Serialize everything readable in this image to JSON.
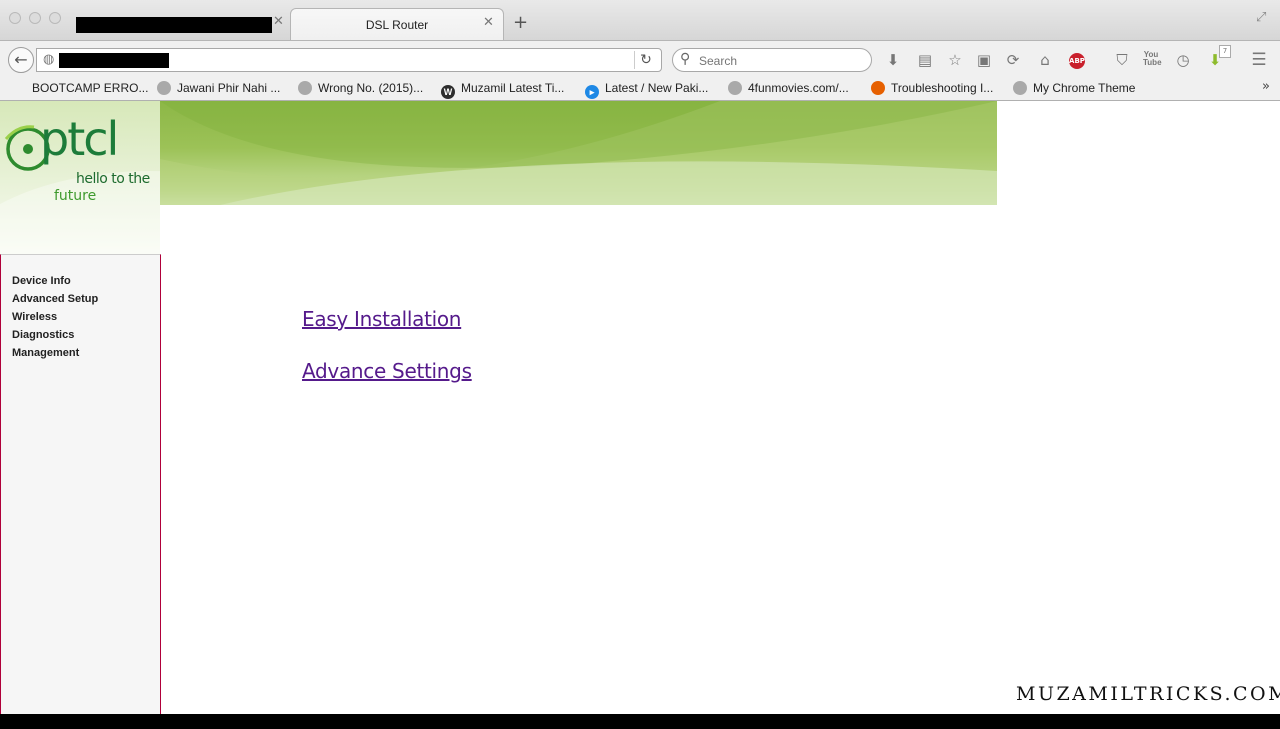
{
  "browser": {
    "tabs": [
      {
        "title": "",
        "redacted": true
      },
      {
        "title": "DSL Router",
        "active": true
      }
    ],
    "new_tab_label": "+",
    "search_placeholder": "Search",
    "toolbar_icons": [
      "download-arrow-icon",
      "folder-icon",
      "star-icon",
      "clipboard-icon",
      "sync-icon",
      "home-icon",
      "adblock-icon",
      "shield-icon",
      "youtube-icon",
      "history-icon",
      "downloader-icon",
      "menu-icon"
    ],
    "abp_label": "ABP",
    "youtube_label": "You Tube",
    "download_badge": "7",
    "bookmarks": [
      {
        "label": "BOOTCAMP ERRO...",
        "icon": "apple-icon"
      },
      {
        "label": "Jawani Phir Nahi ...",
        "icon": "globe-icon"
      },
      {
        "label": "Wrong No. (2015)...",
        "icon": "globe-icon"
      },
      {
        "label": "Muzamil Latest Ti...",
        "icon": "wordpress-icon"
      },
      {
        "label": "Latest / New Paki...",
        "icon": "play-icon"
      },
      {
        "label": "4funmovies.com/...",
        "icon": "globe-icon"
      },
      {
        "label": "Troubleshooting I...",
        "icon": "firefox-icon"
      },
      {
        "label": "My Chrome Theme",
        "icon": "globe-icon"
      }
    ]
  },
  "router": {
    "logo": {
      "brand": "ptcl",
      "tagline_line1": "hello to the",
      "tagline_line2": "future"
    },
    "menu": [
      "Device Info",
      "Advanced Setup",
      "Wireless",
      "Diagnostics",
      "Management"
    ],
    "links": [
      "Easy Installation",
      "Advance Settings"
    ]
  },
  "watermark": "MUZAMILTRICKS.COM",
  "colors": {
    "brand_green": "#1d7c3a",
    "banner_green": "#8cb746",
    "link_visited": "#551a8b",
    "sidebar_border": "#b0003a"
  }
}
